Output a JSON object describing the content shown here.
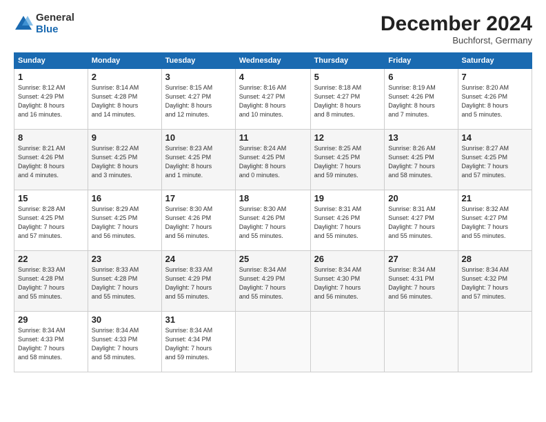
{
  "logo": {
    "general": "General",
    "blue": "Blue"
  },
  "header": {
    "month": "December 2024",
    "location": "Buchforst, Germany"
  },
  "days_of_week": [
    "Sunday",
    "Monday",
    "Tuesday",
    "Wednesday",
    "Thursday",
    "Friday",
    "Saturday"
  ],
  "weeks": [
    [
      {
        "day": "1",
        "info": "Sunrise: 8:12 AM\nSunset: 4:29 PM\nDaylight: 8 hours\nand 16 minutes."
      },
      {
        "day": "2",
        "info": "Sunrise: 8:14 AM\nSunset: 4:28 PM\nDaylight: 8 hours\nand 14 minutes."
      },
      {
        "day": "3",
        "info": "Sunrise: 8:15 AM\nSunset: 4:27 PM\nDaylight: 8 hours\nand 12 minutes."
      },
      {
        "day": "4",
        "info": "Sunrise: 8:16 AM\nSunset: 4:27 PM\nDaylight: 8 hours\nand 10 minutes."
      },
      {
        "day": "5",
        "info": "Sunrise: 8:18 AM\nSunset: 4:27 PM\nDaylight: 8 hours\nand 8 minutes."
      },
      {
        "day": "6",
        "info": "Sunrise: 8:19 AM\nSunset: 4:26 PM\nDaylight: 8 hours\nand 7 minutes."
      },
      {
        "day": "7",
        "info": "Sunrise: 8:20 AM\nSunset: 4:26 PM\nDaylight: 8 hours\nand 5 minutes."
      }
    ],
    [
      {
        "day": "8",
        "info": "Sunrise: 8:21 AM\nSunset: 4:26 PM\nDaylight: 8 hours\nand 4 minutes."
      },
      {
        "day": "9",
        "info": "Sunrise: 8:22 AM\nSunset: 4:25 PM\nDaylight: 8 hours\nand 3 minutes."
      },
      {
        "day": "10",
        "info": "Sunrise: 8:23 AM\nSunset: 4:25 PM\nDaylight: 8 hours\nand 1 minute."
      },
      {
        "day": "11",
        "info": "Sunrise: 8:24 AM\nSunset: 4:25 PM\nDaylight: 8 hours\nand 0 minutes."
      },
      {
        "day": "12",
        "info": "Sunrise: 8:25 AM\nSunset: 4:25 PM\nDaylight: 7 hours\nand 59 minutes."
      },
      {
        "day": "13",
        "info": "Sunrise: 8:26 AM\nSunset: 4:25 PM\nDaylight: 7 hours\nand 58 minutes."
      },
      {
        "day": "14",
        "info": "Sunrise: 8:27 AM\nSunset: 4:25 PM\nDaylight: 7 hours\nand 57 minutes."
      }
    ],
    [
      {
        "day": "15",
        "info": "Sunrise: 8:28 AM\nSunset: 4:25 PM\nDaylight: 7 hours\nand 57 minutes."
      },
      {
        "day": "16",
        "info": "Sunrise: 8:29 AM\nSunset: 4:25 PM\nDaylight: 7 hours\nand 56 minutes."
      },
      {
        "day": "17",
        "info": "Sunrise: 8:30 AM\nSunset: 4:26 PM\nDaylight: 7 hours\nand 56 minutes."
      },
      {
        "day": "18",
        "info": "Sunrise: 8:30 AM\nSunset: 4:26 PM\nDaylight: 7 hours\nand 55 minutes."
      },
      {
        "day": "19",
        "info": "Sunrise: 8:31 AM\nSunset: 4:26 PM\nDaylight: 7 hours\nand 55 minutes."
      },
      {
        "day": "20",
        "info": "Sunrise: 8:31 AM\nSunset: 4:27 PM\nDaylight: 7 hours\nand 55 minutes."
      },
      {
        "day": "21",
        "info": "Sunrise: 8:32 AM\nSunset: 4:27 PM\nDaylight: 7 hours\nand 55 minutes."
      }
    ],
    [
      {
        "day": "22",
        "info": "Sunrise: 8:33 AM\nSunset: 4:28 PM\nDaylight: 7 hours\nand 55 minutes."
      },
      {
        "day": "23",
        "info": "Sunrise: 8:33 AM\nSunset: 4:28 PM\nDaylight: 7 hours\nand 55 minutes."
      },
      {
        "day": "24",
        "info": "Sunrise: 8:33 AM\nSunset: 4:29 PM\nDaylight: 7 hours\nand 55 minutes."
      },
      {
        "day": "25",
        "info": "Sunrise: 8:34 AM\nSunset: 4:29 PM\nDaylight: 7 hours\nand 55 minutes."
      },
      {
        "day": "26",
        "info": "Sunrise: 8:34 AM\nSunset: 4:30 PM\nDaylight: 7 hours\nand 56 minutes."
      },
      {
        "day": "27",
        "info": "Sunrise: 8:34 AM\nSunset: 4:31 PM\nDaylight: 7 hours\nand 56 minutes."
      },
      {
        "day": "28",
        "info": "Sunrise: 8:34 AM\nSunset: 4:32 PM\nDaylight: 7 hours\nand 57 minutes."
      }
    ],
    [
      {
        "day": "29",
        "info": "Sunrise: 8:34 AM\nSunset: 4:33 PM\nDaylight: 7 hours\nand 58 minutes."
      },
      {
        "day": "30",
        "info": "Sunrise: 8:34 AM\nSunset: 4:33 PM\nDaylight: 7 hours\nand 58 minutes."
      },
      {
        "day": "31",
        "info": "Sunrise: 8:34 AM\nSunset: 4:34 PM\nDaylight: 7 hours\nand 59 minutes."
      },
      {
        "day": "",
        "info": ""
      },
      {
        "day": "",
        "info": ""
      },
      {
        "day": "",
        "info": ""
      },
      {
        "day": "",
        "info": ""
      }
    ]
  ]
}
